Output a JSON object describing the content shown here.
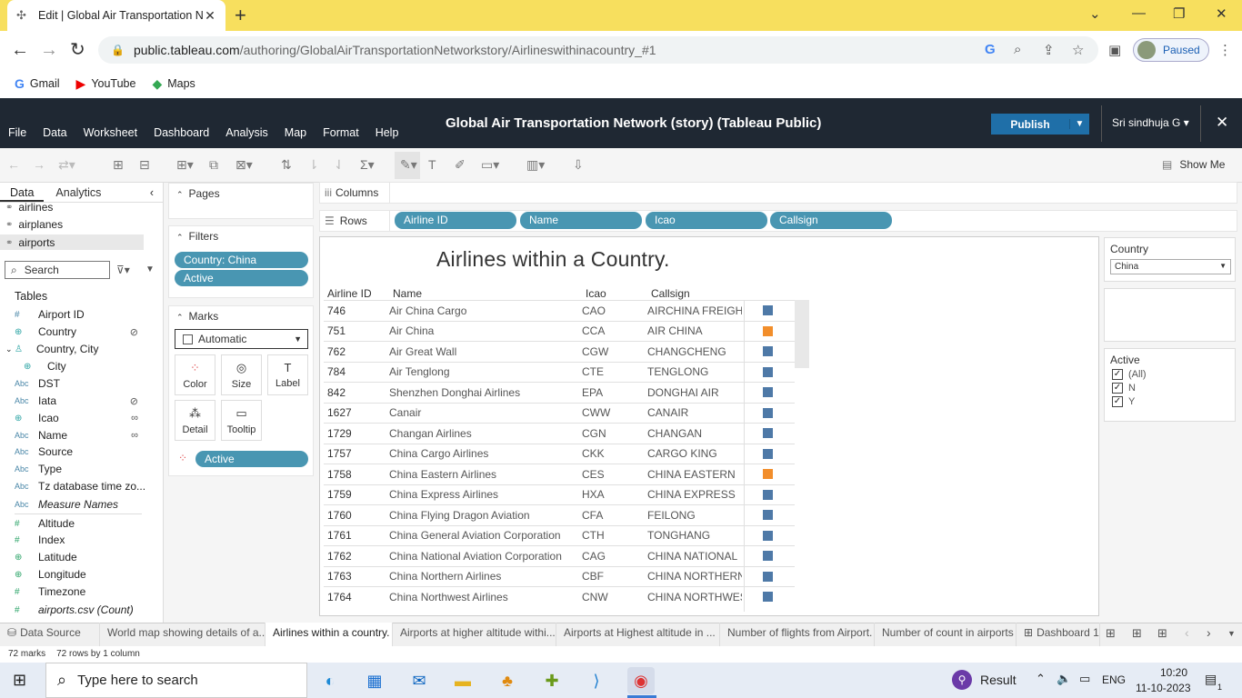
{
  "browser": {
    "tab_title": "Edit | Global Air Transportation N",
    "url_domain": "public.tableau.com",
    "url_path": "/authoring/GlobalAirTransportationNetworkstory/Airlineswithinacountry_#1",
    "profile_status": "Paused",
    "bookmarks": [
      "Gmail",
      "YouTube",
      "Maps"
    ]
  },
  "tableau": {
    "menus": [
      "File",
      "Data",
      "Worksheet",
      "Dashboard",
      "Analysis",
      "Map",
      "Format",
      "Help"
    ],
    "workbook_title": "Global Air Transportation Network (story) (Tableau Public)",
    "publish_label": "Publish",
    "user_name": "Sri sindhuja G ▾",
    "show_me": "Show Me"
  },
  "data_pane": {
    "tabs": [
      "Data",
      "Analytics"
    ],
    "datasources": [
      "airlines",
      "airplanes",
      "airports"
    ],
    "search_placeholder": "Search",
    "tables_label": "Tables",
    "fields": [
      {
        "name": "Airport ID",
        "type": "#"
      },
      {
        "name": "Country",
        "type": "geo"
      },
      {
        "name": "Country, City",
        "type": "hier"
      },
      {
        "name": "City",
        "type": "geo"
      },
      {
        "name": "DST",
        "type": "Abc"
      },
      {
        "name": "Iata",
        "type": "Abc"
      },
      {
        "name": "Icao",
        "type": "geo"
      },
      {
        "name": "Name",
        "type": "Abc"
      },
      {
        "name": "Source",
        "type": "Abc"
      },
      {
        "name": "Type",
        "type": "Abc"
      },
      {
        "name": "Tz database time zo...",
        "type": "Abc"
      },
      {
        "name": "Measure Names",
        "type": "Abc"
      },
      {
        "name": "Altitude",
        "type": "#"
      },
      {
        "name": "Index",
        "type": "#"
      },
      {
        "name": "Latitude",
        "type": "geo"
      },
      {
        "name": "Longitude",
        "type": "geo"
      },
      {
        "name": "Timezone",
        "type": "#"
      },
      {
        "name": "airports.csv (Count)",
        "type": "#"
      }
    ]
  },
  "shelves": {
    "pages_label": "Pages",
    "filters_label": "Filters",
    "filters": [
      "Country: China",
      "Active"
    ],
    "marks_label": "Marks",
    "mark_type": "Automatic",
    "mark_buttons": [
      "Color",
      "Size",
      "Label",
      "Detail",
      "Tooltip"
    ],
    "color_pill": "Active",
    "columns_label": "Columns",
    "rows_label": "Rows",
    "row_pills": [
      "Airline ID",
      "Name",
      "Icao",
      "Callsign"
    ]
  },
  "view": {
    "title": "Airlines within a Country.",
    "headers": [
      "Airline ID",
      "Name",
      "Icao",
      "Callsign"
    ],
    "rows": [
      {
        "id": "746",
        "name": "Air China Cargo",
        "icao": "CAO",
        "callsign": "AIRCHINA FREIGHT",
        "active": "N"
      },
      {
        "id": "751",
        "name": "Air China",
        "icao": "CCA",
        "callsign": "AIR CHINA",
        "active": "Y"
      },
      {
        "id": "762",
        "name": "Air Great Wall",
        "icao": "CGW",
        "callsign": "CHANGCHENG",
        "active": "N"
      },
      {
        "id": "784",
        "name": "Air Tenglong",
        "icao": "CTE",
        "callsign": "TENGLONG",
        "active": "N"
      },
      {
        "id": "842",
        "name": "Shenzhen Donghai Airlines",
        "icao": "EPA",
        "callsign": "DONGHAI AIR",
        "active": "N"
      },
      {
        "id": "1627",
        "name": "Canair",
        "icao": "CWW",
        "callsign": "CANAIR",
        "active": "N"
      },
      {
        "id": "1729",
        "name": "Changan Airlines",
        "icao": "CGN",
        "callsign": "CHANGAN",
        "active": "N"
      },
      {
        "id": "1757",
        "name": "China Cargo Airlines",
        "icao": "CKK",
        "callsign": "CARGO KING",
        "active": "N"
      },
      {
        "id": "1758",
        "name": "China Eastern Airlines",
        "icao": "CES",
        "callsign": "CHINA EASTERN",
        "active": "Y"
      },
      {
        "id": "1759",
        "name": "China Express Airlines",
        "icao": "HXA",
        "callsign": "CHINA EXPRESS",
        "active": "N"
      },
      {
        "id": "1760",
        "name": "China Flying Dragon Aviation",
        "icao": "CFA",
        "callsign": "FEILONG",
        "active": "N"
      },
      {
        "id": "1761",
        "name": "China General Aviation Corporation",
        "icao": "CTH",
        "callsign": "TONGHANG",
        "active": "N"
      },
      {
        "id": "1762",
        "name": "China National Aviation Corporation",
        "icao": "CAG",
        "callsign": "CHINA NATIONAL",
        "active": "N"
      },
      {
        "id": "1763",
        "name": "China Northern Airlines",
        "icao": "CBF",
        "callsign": "CHINA NORTHERN",
        "active": "N"
      },
      {
        "id": "1764",
        "name": "China Northwest Airlines",
        "icao": "CNW",
        "callsign": "CHINA NORTHWEST",
        "active": "N"
      }
    ],
    "colors": {
      "N": "#4e79a7",
      "Y": "#f28e2b"
    }
  },
  "right_panel": {
    "country_label": "Country",
    "country_value": "China",
    "active_label": "Active",
    "active_options": [
      "(All)",
      "N",
      "Y"
    ]
  },
  "sheet_tabs": [
    "Data Source",
    "World map showing details of a...",
    "Airlines within a country.",
    "Airports at higher altitude withi...",
    "Airports at Highest altitude in ...",
    "Number of flights from Airport.",
    "Number of count in airports",
    "Dashboard 1"
  ],
  "status": {
    "marks": "72 marks",
    "rows": "72 rows by 1 column"
  },
  "taskbar": {
    "search_placeholder": "Type here to search",
    "result_label": "Result",
    "lang": "ENG",
    "time": "10:20",
    "date": "11-10-2023",
    "notif_count": "1"
  }
}
